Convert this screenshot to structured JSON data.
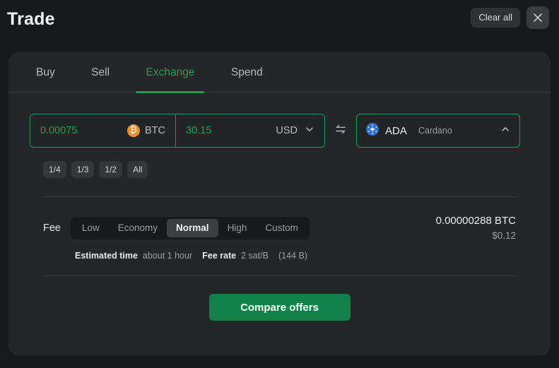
{
  "header": {
    "title": "Trade",
    "clear_all_label": "Clear all",
    "close_label": "×"
  },
  "tabs": [
    {
      "label": "Buy",
      "active": false
    },
    {
      "label": "Sell",
      "active": false
    },
    {
      "label": "Exchange",
      "active": true
    },
    {
      "label": "Spend",
      "active": false
    }
  ],
  "swap": {
    "from": {
      "amount": "0.00075",
      "symbol": "BTC",
      "icon": "bitcoin-icon"
    },
    "fiat": {
      "amount": "30.15",
      "symbol": "USD",
      "icon": "chevron-down-icon"
    },
    "swap_icon": "swap-arrows-icon",
    "to": {
      "symbol": "ADA",
      "name": "Cardano",
      "icon": "cardano-icon",
      "chevron": "chevron-up-icon"
    }
  },
  "quick_amounts": [
    "1/4",
    "1/3",
    "1/2",
    "All"
  ],
  "fee": {
    "label": "Fee",
    "options": [
      "Low",
      "Economy",
      "Normal",
      "High",
      "Custom"
    ],
    "selected": "Normal",
    "crypto_amount": "0.00000288 BTC",
    "fiat_amount": "$0.12",
    "estimated_time_label": "Estimated time",
    "estimated_time_value": "about 1 hour",
    "fee_rate_label": "Fee rate",
    "fee_rate_value": "2 sat/B",
    "fee_rate_size": "(144 B)"
  },
  "cta": {
    "label": "Compare offers"
  },
  "colors": {
    "accent_green": "#17a05b",
    "cta_green": "#11814a",
    "page_bg": "#18191b",
    "card_bg": "#252628",
    "btc_orange": "#e8912a",
    "ada_blue": "#2f6fd0"
  }
}
